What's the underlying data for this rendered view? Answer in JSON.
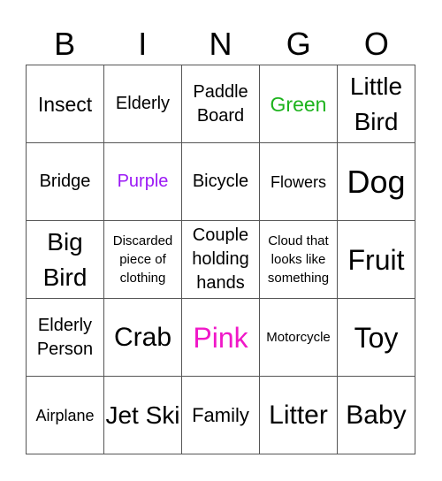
{
  "header": [
    "B",
    "I",
    "N",
    "G",
    "O"
  ],
  "colors": {
    "green": "#1db31d",
    "purple": "#9b19f5",
    "pink": "#f018c8",
    "text": "#000000",
    "grid": "#555555"
  },
  "cells": [
    {
      "text": "Insect",
      "size": "s23",
      "color": ""
    },
    {
      "text": "Elderly",
      "size": "s20",
      "color": ""
    },
    {
      "text": "Paddle Board",
      "size": "s20",
      "color": ""
    },
    {
      "text": "Green",
      "size": "s23",
      "color": "green"
    },
    {
      "text": "Little Bird",
      "size": "s28",
      "color": ""
    },
    {
      "text": "Bridge",
      "size": "s20",
      "color": ""
    },
    {
      "text": "Purple",
      "size": "s20",
      "color": "purple"
    },
    {
      "text": "Bicycle",
      "size": "s20",
      "color": ""
    },
    {
      "text": "Flowers",
      "size": "s18",
      "color": ""
    },
    {
      "text": "Dog",
      "size": "s36",
      "color": ""
    },
    {
      "text": "Big Bird",
      "size": "s28",
      "color": ""
    },
    {
      "text": "Discarded piece of clothing",
      "size": "s15",
      "color": ""
    },
    {
      "text": "Couple holding hands",
      "size": "s20",
      "color": ""
    },
    {
      "text": "Cloud that looks like something",
      "size": "s15",
      "color": ""
    },
    {
      "text": "Fruit",
      "size": "s32",
      "color": ""
    },
    {
      "text": "Elderly Person",
      "size": "s20",
      "color": ""
    },
    {
      "text": "Crab",
      "size": "s30",
      "color": ""
    },
    {
      "text": "Pink",
      "size": "s32",
      "color": "pink"
    },
    {
      "text": "Motorcycle",
      "size": "s15",
      "color": ""
    },
    {
      "text": "Toy",
      "size": "s32",
      "color": ""
    },
    {
      "text": "Airplane",
      "size": "s18",
      "color": ""
    },
    {
      "text": "Jet Ski",
      "size": "s28",
      "color": ""
    },
    {
      "text": "Family",
      "size": "s22",
      "color": ""
    },
    {
      "text": "Litter",
      "size": "s30",
      "color": ""
    },
    {
      "text": "Baby",
      "size": "s30",
      "color": ""
    }
  ]
}
